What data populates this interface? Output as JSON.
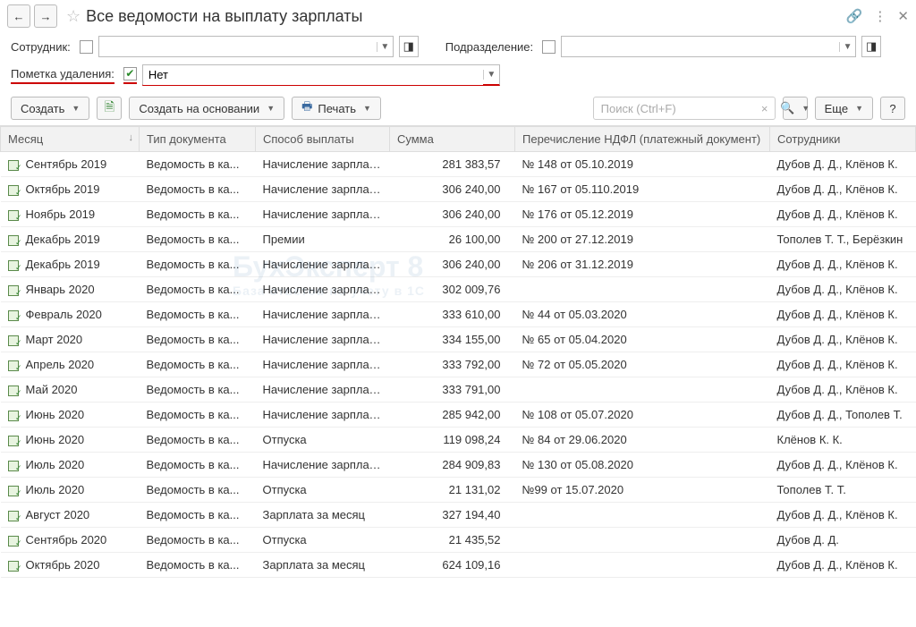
{
  "header": {
    "title": "Все ведомости на выплату зарплаты"
  },
  "filters": {
    "employee_label": "Сотрудник:",
    "employee_value": "",
    "department_label": "Подразделение:",
    "department_value": "",
    "deletion_mark_label": "Пометка удаления:",
    "deletion_mark_value": "Нет"
  },
  "toolbar": {
    "create": "Создать",
    "create_based_on": "Создать на основании",
    "print": "Печать",
    "search_placeholder": "Поиск (Ctrl+F)",
    "more": "Еще"
  },
  "columns": {
    "month": "Месяц",
    "doc_type": "Тип документа",
    "pay_method": "Способ выплаты",
    "sum": "Сумма",
    "ndfl": "Перечисление НДФЛ (платежный документ)",
    "employees": "Сотрудники"
  },
  "rows": [
    {
      "month": "Сентябрь 2019",
      "doc_type": "Ведомость в ка...",
      "pay_method": "Начисление зарплаты",
      "sum": "281 383,57",
      "ndfl": "№ 148 от 05.10.2019",
      "employees": "Дубов Д. Д., Клёнов К."
    },
    {
      "month": "Октябрь 2019",
      "doc_type": "Ведомость в ка...",
      "pay_method": "Начисление зарплаты",
      "sum": "306 240,00",
      "ndfl": "№ 167 от 05.110.2019",
      "employees": "Дубов Д. Д., Клёнов К."
    },
    {
      "month": "Ноябрь 2019",
      "doc_type": "Ведомость в ка...",
      "pay_method": "Начисление зарплаты",
      "sum": "306 240,00",
      "ndfl": "№ 176 от 05.12.2019",
      "employees": "Дубов Д. Д., Клёнов К."
    },
    {
      "month": "Декабрь 2019",
      "doc_type": "Ведомость в ка...",
      "pay_method": "Премии",
      "sum": "26 100,00",
      "ndfl": "№ 200 от 27.12.2019",
      "employees": "Тополев Т. Т., Берёзкин"
    },
    {
      "month": "Декабрь 2019",
      "doc_type": "Ведомость в ка...",
      "pay_method": "Начисление зарплаты",
      "sum": "306 240,00",
      "ndfl": "№ 206 от 31.12.2019",
      "employees": "Дубов Д. Д., Клёнов К."
    },
    {
      "month": "Январь 2020",
      "doc_type": "Ведомость в ка...",
      "pay_method": "Начисление зарплаты",
      "sum": "302 009,76",
      "ndfl": "",
      "employees": "Дубов Д. Д., Клёнов К."
    },
    {
      "month": "Февраль 2020",
      "doc_type": "Ведомость в ка...",
      "pay_method": "Начисление зарплаты",
      "sum": "333 610,00",
      "ndfl": "№ 44 от 05.03.2020",
      "employees": "Дубов Д. Д., Клёнов К."
    },
    {
      "month": "Март 2020",
      "doc_type": "Ведомость в ка...",
      "pay_method": "Начисление зарплаты",
      "sum": "334 155,00",
      "ndfl": "№ 65 от 05.04.2020",
      "employees": "Дубов Д. Д., Клёнов К."
    },
    {
      "month": "Апрель 2020",
      "doc_type": "Ведомость в ка...",
      "pay_method": "Начисление зарплаты",
      "sum": "333 792,00",
      "ndfl": "№ 72 от 05.05.2020",
      "employees": "Дубов Д. Д., Клёнов К."
    },
    {
      "month": "Май 2020",
      "doc_type": "Ведомость в ка...",
      "pay_method": "Начисление зарплаты",
      "sum": "333 791,00",
      "ndfl": "",
      "employees": "Дубов Д. Д., Клёнов К."
    },
    {
      "month": "Июнь 2020",
      "doc_type": "Ведомость в ка...",
      "pay_method": "Начисление зарплаты",
      "sum": "285 942,00",
      "ndfl": "№ 108 от 05.07.2020",
      "employees": "Дубов Д. Д., Тополев Т."
    },
    {
      "month": "Июнь 2020",
      "doc_type": "Ведомость в ка...",
      "pay_method": "Отпуска",
      "sum": "119 098,24",
      "ndfl": "№ 84 от 29.06.2020",
      "employees": "Клёнов К. К."
    },
    {
      "month": "Июль 2020",
      "doc_type": "Ведомость в ка...",
      "pay_method": "Начисление зарплаты",
      "sum": "284 909,83",
      "ndfl": "№ 130 от 05.08.2020",
      "employees": "Дубов Д. Д., Клёнов К."
    },
    {
      "month": "Июль 2020",
      "doc_type": "Ведомость в ка...",
      "pay_method": "Отпуска",
      "sum": "21 131,02",
      "ndfl": "№99 от 15.07.2020",
      "employees": "Тополев Т. Т."
    },
    {
      "month": "Август 2020",
      "doc_type": "Ведомость в ка...",
      "pay_method": "Зарплата за месяц",
      "sum": "327 194,40",
      "ndfl": "",
      "employees": "Дубов Д. Д., Клёнов К."
    },
    {
      "month": "Сентябрь 2020",
      "doc_type": "Ведомость в ка...",
      "pay_method": "Отпуска",
      "sum": "21 435,52",
      "ndfl": "",
      "employees": "Дубов Д. Д."
    },
    {
      "month": "Октябрь 2020",
      "doc_type": "Ведомость в ка...",
      "pay_method": "Зарплата за месяц",
      "sum": "624 109,16",
      "ndfl": "",
      "employees": "Дубов Д. Д., Клёнов К."
    }
  ],
  "watermark": {
    "line1": "БухЭксперт 8",
    "line2": "База ответов по учету в 1С"
  }
}
